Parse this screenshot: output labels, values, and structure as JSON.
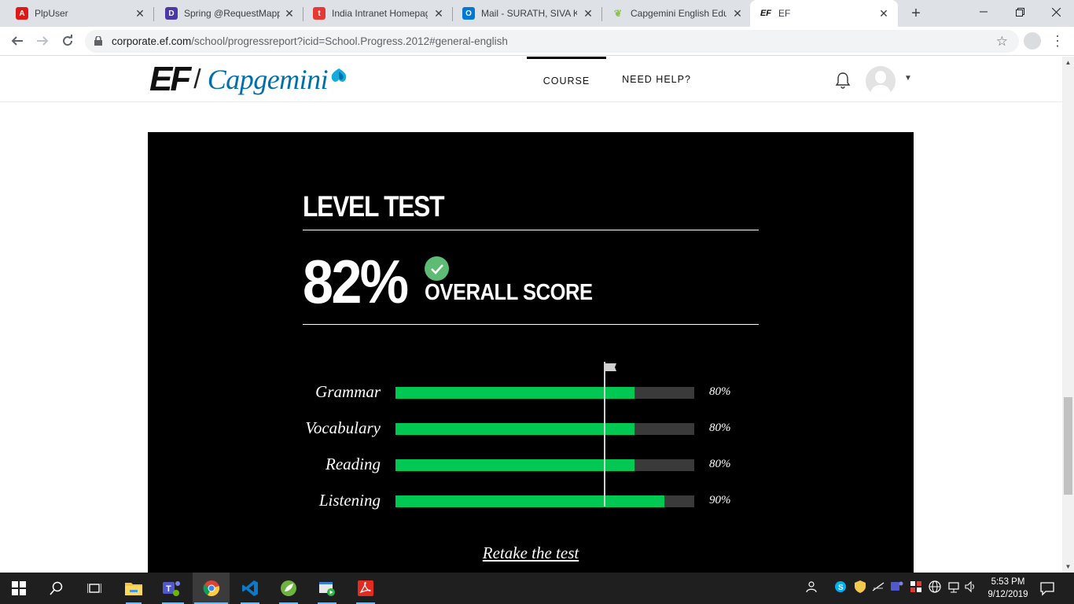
{
  "browser": {
    "tabs": [
      {
        "title": "PlpUser",
        "icon": "angular-icon",
        "color": "#dd1b16"
      },
      {
        "title": "Spring @RequestMapp",
        "icon": "baeldung-icon",
        "color": "#63b0f4"
      },
      {
        "title": "India Intranet Homepag",
        "icon": "intranet-icon",
        "color": "#e53935"
      },
      {
        "title": "Mail - SURATH, SIVA KU",
        "icon": "outlook-icon",
        "color": "#0078d4"
      },
      {
        "title": "Capgemini English Educ",
        "icon": "capgemini-ef-icon",
        "color": "#8bc34a"
      },
      {
        "title": "EF",
        "icon": "ef-icon",
        "color": "#111111"
      }
    ],
    "url_host": "corporate.ef.com",
    "url_path": "/school/progressreport?icid=School.Progress.2012#general-english"
  },
  "site": {
    "nav": {
      "course": "COURSE",
      "help": "NEED HELP?"
    }
  },
  "level_test": {
    "title": "LEVEL TEST",
    "score": "82%",
    "score_label": "OVERALL SCORE",
    "passed": true,
    "pass_mark": 0.7,
    "skills": [
      {
        "label": "Grammar",
        "value": 0.8,
        "pct": "80%"
      },
      {
        "label": "Vocabulary",
        "value": 0.8,
        "pct": "80%"
      },
      {
        "label": "Reading",
        "value": 0.8,
        "pct": "80%"
      },
      {
        "label": "Listening",
        "value": 0.9,
        "pct": "90%"
      }
    ],
    "retake_label": "Retake the test",
    "bar_color": "#00c853",
    "check_color": "#5dbb74"
  },
  "taskbar": {
    "time": "5:53 PM",
    "date": "9/12/2019"
  }
}
